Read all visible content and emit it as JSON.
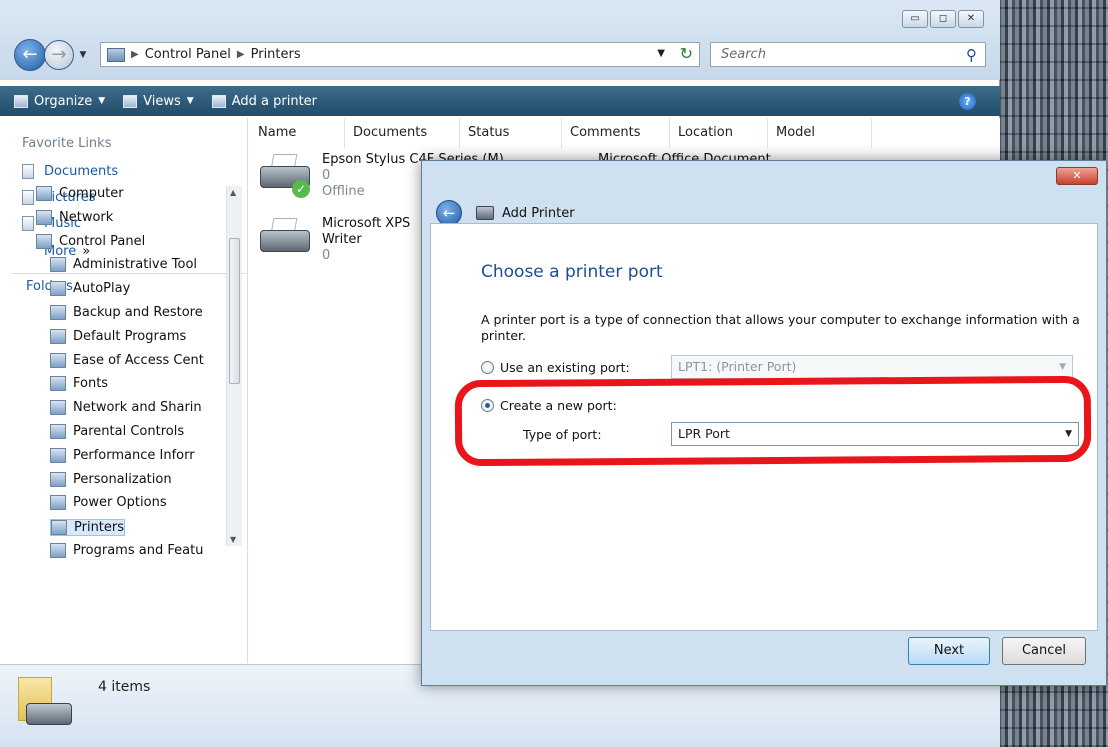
{
  "explorer": {
    "breadcrumb": [
      "Control Panel",
      "Printers"
    ],
    "search_placeholder": "Search",
    "toolbar": {
      "organize": "Organize",
      "views": "Views",
      "add_printer": "Add a printer"
    },
    "favorite_links_title": "Favorite Links",
    "favorite_links": [
      "Documents",
      "Pictures",
      "Music"
    ],
    "more_label": "More",
    "more_chevron": "»",
    "folders_label": "Folders",
    "tree": [
      "Computer",
      "Network",
      "Control Panel",
      "Administrative Tool",
      "AutoPlay",
      "Backup and Restore",
      "Default Programs",
      "Ease of Access Cent",
      "Fonts",
      "Network and Sharin",
      "Parental Controls",
      "Performance Inforr",
      "Personalization",
      "Power Options",
      "Printers",
      "Programs and Featu"
    ],
    "selected_tree_item": "Printers",
    "columns": [
      "Name",
      "Documents",
      "Status",
      "Comments",
      "Location",
      "Model"
    ],
    "printers": [
      {
        "name": "Epson Stylus C4F Series (M)",
        "docs": "0",
        "status": "Offline",
        "comment": "Microsoft Office Document"
      },
      {
        "name_line1": "Microsoft XPS",
        "name_line2": "Writer",
        "docs": "0"
      }
    ],
    "status_count": "4 items"
  },
  "dialog": {
    "title": "Add Printer",
    "heading": "Choose a printer port",
    "description": "A printer port is a type of connection that allows your computer to exchange information with a printer.",
    "existing_port_label": "Use an existing port:",
    "existing_port_value": "LPT1: (Printer Port)",
    "new_port_label": "Create a new port:",
    "type_of_port_label": "Type of port:",
    "type_of_port_value": "LPR Port",
    "next": "Next",
    "cancel": "Cancel",
    "close_glyph": "✕",
    "selected_option": "Create a new port"
  },
  "colors": {
    "highlight": "#e8161a",
    "link": "#1c58a8",
    "toolbar": "#214b69",
    "heading": "#1c4f90"
  }
}
